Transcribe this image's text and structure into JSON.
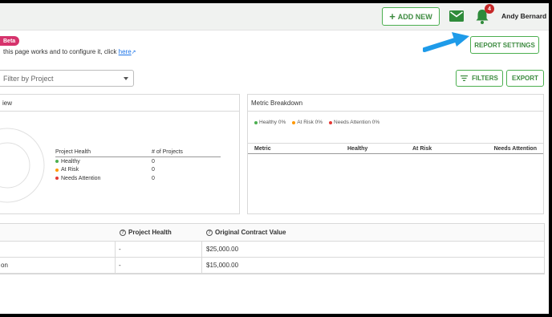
{
  "header": {
    "add_new_label": "ADD NEW",
    "notification_count": "4",
    "user_name": "Andy Bernard"
  },
  "intro": {
    "beta_label": "Beta",
    "help_text": "this page works and to configure it, click ",
    "help_link": "here"
  },
  "toolbar": {
    "report_settings_label": "REPORT SETTINGS",
    "filter_placeholder": "Filter by Project",
    "filters_label": "FILTERS",
    "export_label": "EXPORT"
  },
  "overview_card": {
    "title": "iew",
    "table_headers": [
      "Project Health",
      "# of Projects"
    ],
    "rows": [
      {
        "label": "Healthy",
        "count": "0",
        "color": "#4caf50"
      },
      {
        "label": "At Risk",
        "count": "0",
        "color": "#ff9800"
      },
      {
        "label": "Needs Attention",
        "count": "0",
        "color": "#e53935"
      }
    ]
  },
  "metric_card": {
    "title": "Metric Breakdown",
    "legend": [
      {
        "label": "Healthy 0%",
        "color": "#4caf50"
      },
      {
        "label": "At Risk 0%",
        "color": "#ff9800"
      },
      {
        "label": "Needs Attention 0%",
        "color": "#e53935"
      }
    ],
    "headers": {
      "metric": "Metric",
      "healthy": "Healthy",
      "at_risk": "At Risk",
      "needs_attention": "Needs Attention"
    }
  },
  "bottom_table": {
    "headers": {
      "project_health": "Project Health",
      "contract_value": "Original Contract Value"
    },
    "rows": [
      {
        "name": "",
        "health": "-",
        "value": "$25,000.00"
      },
      {
        "name": "on",
        "health": "-",
        "value": "$15,000.00"
      }
    ]
  },
  "colors": {
    "accent_green": "#4caf50",
    "arrow_blue": "#1e9be9",
    "badge_red": "#c62828",
    "beta_pink": "#d6336c"
  }
}
